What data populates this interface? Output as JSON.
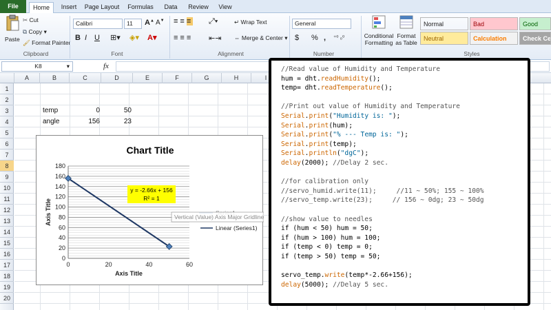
{
  "tabs": [
    "File",
    "Home",
    "Insert",
    "Page Layout",
    "Formulas",
    "Data",
    "Review",
    "View"
  ],
  "clipboard": {
    "paste": "Paste",
    "cut": "Cut",
    "copy": "Copy",
    "format_painter": "Format Painter",
    "group": "Clipboard"
  },
  "font": {
    "name": "Calibri",
    "size": "11",
    "bold": "B",
    "italic": "I",
    "underline": "U",
    "group": "Font"
  },
  "alignment": {
    "wrap": "Wrap Text",
    "merge": "Merge & Center",
    "group": "Alignment"
  },
  "number": {
    "format": "General",
    "currency": "$",
    "percent": "%",
    "comma": ",",
    "group": "Number"
  },
  "styles": {
    "conditional": "Conditional",
    "formatting": "Formatting",
    "format_as": "Format",
    "as_table": "as Table",
    "group": "Styles",
    "cells": [
      {
        "label": "Normal",
        "bg": "#ffffff",
        "fg": "#000000"
      },
      {
        "label": "Bad",
        "bg": "#ffc7ce",
        "fg": "#9c0006"
      },
      {
        "label": "Good",
        "bg": "#c6efce",
        "fg": "#006100"
      },
      {
        "label": "Neutral",
        "bg": "#ffeb9c",
        "fg": "#9c6500"
      },
      {
        "label": "Calculation",
        "bg": "#f2f2f2",
        "fg": "#fa7d00"
      },
      {
        "label": "Check Cell",
        "bg": "#a5a5a5",
        "fg": "#ffffff"
      }
    ]
  },
  "formula_bar": {
    "name_box": "K8",
    "fx": "fx",
    "value": ""
  },
  "columns": [
    "A",
    "B",
    "C",
    "D",
    "E",
    "F",
    "G",
    "H",
    "I"
  ],
  "rows": [
    "1",
    "2",
    "3",
    "4",
    "5",
    "6",
    "7",
    "8",
    "9",
    "10",
    "11",
    "12",
    "13",
    "14",
    "15",
    "16",
    "17",
    "18",
    "19",
    "20"
  ],
  "sheet_cells": {
    "b3": "temp",
    "c3": "0",
    "d3": "50",
    "b4": "angle",
    "c4": "156",
    "d4": "23"
  },
  "chart_data": {
    "type": "scatter",
    "title": "Chart Title",
    "xlabel": "Axis Title",
    "ylabel": "Axis Title",
    "xlim": [
      0,
      60
    ],
    "ylim": [
      0,
      180
    ],
    "x_ticks": [
      "0",
      "20",
      "40",
      "60"
    ],
    "y_ticks": [
      "0",
      "20",
      "40",
      "60",
      "80",
      "100",
      "120",
      "140",
      "160",
      "180"
    ],
    "series": [
      {
        "name": "Series1",
        "x": [
          0,
          50
        ],
        "y": [
          156,
          23
        ]
      }
    ],
    "trendline": {
      "label": "Linear (Series1)",
      "equation": "y = -2.66x + 156",
      "r2": "R² = 1"
    },
    "legend": [
      "Series1",
      "Linear (Series1)"
    ],
    "tooltip": "Vertical (Value) Axis Major Gridlines",
    "grid": true
  },
  "code": [
    [
      [
        "//Read value of Humidity and Temperature",
        "c"
      ]
    ],
    [
      [
        "hum = dht.",
        "n"
      ],
      [
        "readHumidity",
        "o"
      ],
      [
        "();",
        "n"
      ]
    ],
    [
      [
        "temp= dht.",
        "n"
      ],
      [
        "readTemperature",
        "o"
      ],
      [
        "();",
        "n"
      ]
    ],
    [
      [
        "",
        ""
      ]
    ],
    [
      [
        "//Print out value of Humidity and Temperature",
        "c"
      ]
    ],
    [
      [
        "Serial",
        "o"
      ],
      [
        ".",
        "n"
      ],
      [
        "print",
        "o"
      ],
      [
        "(",
        "n"
      ],
      [
        "\"Humidity is: \"",
        "b"
      ],
      [
        ");",
        "n"
      ]
    ],
    [
      [
        "Serial",
        "o"
      ],
      [
        ".",
        "n"
      ],
      [
        "print",
        "o"
      ],
      [
        "(hum);",
        "n"
      ]
    ],
    [
      [
        "Serial",
        "o"
      ],
      [
        ".",
        "n"
      ],
      [
        "print",
        "o"
      ],
      [
        "(",
        "n"
      ],
      [
        "\"% --- Temp is: \"",
        "b"
      ],
      [
        ");",
        "n"
      ]
    ],
    [
      [
        "Serial",
        "o"
      ],
      [
        ".",
        "n"
      ],
      [
        "print",
        "o"
      ],
      [
        "(temp);",
        "n"
      ]
    ],
    [
      [
        "Serial",
        "o"
      ],
      [
        ".",
        "n"
      ],
      [
        "println",
        "o"
      ],
      [
        "(",
        "n"
      ],
      [
        "\"dgC\"",
        "b"
      ],
      [
        ");",
        "n"
      ]
    ],
    [
      [
        "delay",
        "o"
      ],
      [
        "(2000); ",
        "n"
      ],
      [
        "//Delay 2 sec.",
        "c"
      ]
    ],
    [
      [
        "",
        ""
      ]
    ],
    [
      [
        "//for calibration only",
        "c"
      ]
    ],
    [
      [
        "//servo_humid.write(11);     //11 ~ 50%; 155 ~ 100%",
        "c"
      ]
    ],
    [
      [
        "//servo_temp.write(23);     // 156 ~ 0dg; 23 ~ 50dg",
        "c"
      ]
    ],
    [
      [
        "",
        ""
      ]
    ],
    [
      [
        "//show value to needles",
        "c"
      ]
    ],
    [
      [
        "if (hum < 50) hum = 50;",
        "n"
      ]
    ],
    [
      [
        "if (hum > 100) hum = 100;",
        "n"
      ]
    ],
    [
      [
        "if (temp < 0) temp = 0;",
        "n"
      ]
    ],
    [
      [
        "if (temp > 50) temp = 50;",
        "n"
      ]
    ],
    [
      [
        "",
        ""
      ]
    ],
    [
      [
        "servo_temp.",
        "n"
      ],
      [
        "write",
        "o"
      ],
      [
        "(temp*-2.66+156);",
        "n"
      ]
    ],
    [
      [
        "delay",
        "o"
      ],
      [
        "(5000); ",
        "n"
      ],
      [
        "//Delay 5 sec.",
        "c"
      ]
    ]
  ],
  "colors": {
    "comment": "#555555",
    "keyword": "#cc6600",
    "string": "#006699",
    "normal": "#000000",
    "accent": "#2a6c2a",
    "trend": "#1f3864"
  }
}
